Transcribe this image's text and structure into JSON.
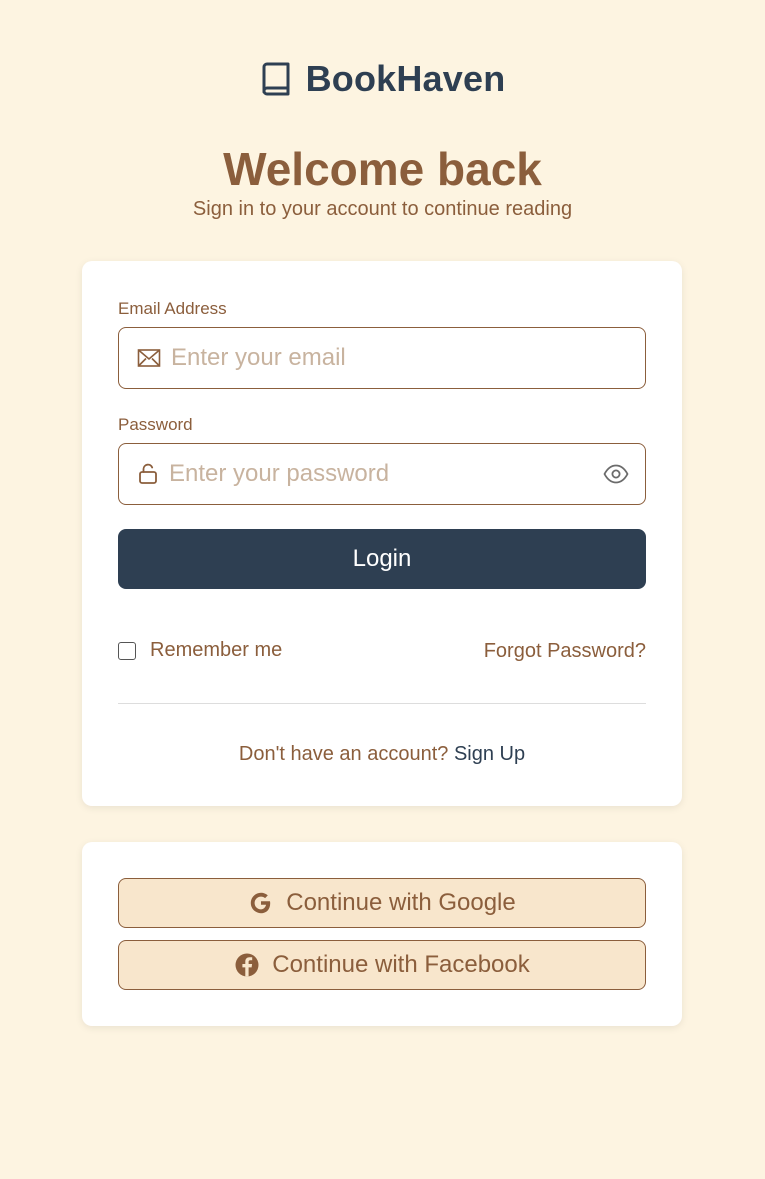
{
  "brand": {
    "name": "BookHaven",
    "icon": "book-icon"
  },
  "header": {
    "title": "Welcome back",
    "subtitle": "Sign in to your account to continue reading"
  },
  "login_form": {
    "email": {
      "label": "Email Address",
      "placeholder": "Enter your email",
      "value": "",
      "icon": "mail-icon"
    },
    "password": {
      "label": "Password",
      "placeholder": "Enter your password",
      "value": "",
      "icon": "lock-icon",
      "toggle_icon": "eye-icon"
    },
    "submit_label": "Login",
    "remember_label": "Remember me",
    "remember_checked": false,
    "forgot_label": "Forgot Password?",
    "signup_prompt": "Don't have an account?",
    "signup_link": "Sign Up"
  },
  "social": {
    "google_label": "Continue with Google",
    "google_icon": "google-icon",
    "facebook_label": "Continue with Facebook",
    "facebook_icon": "facebook-icon"
  },
  "colors": {
    "background": "#fdf4e1",
    "primary": "#2e3f52",
    "accent": "#8b5e3c",
    "social_button_bg": "#f8e6cc"
  }
}
